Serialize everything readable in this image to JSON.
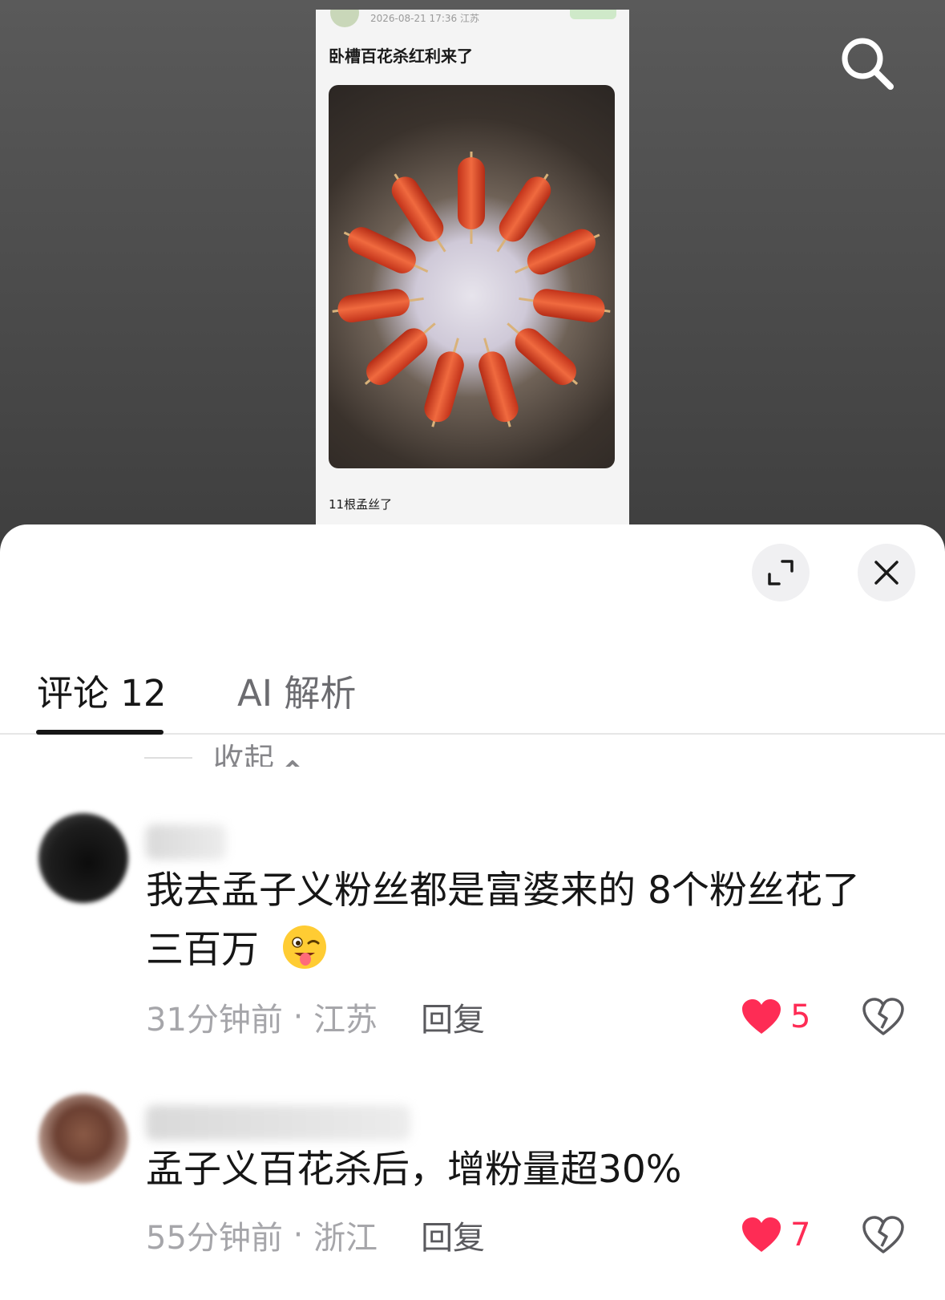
{
  "post": {
    "meta": "2026-08-21 17:36 江苏",
    "title": "卧槽百花杀红利来了",
    "caption": "11根孟丝了"
  },
  "sheet": {
    "tabs": [
      {
        "label": "评论 12",
        "active": true
      },
      {
        "label": "AI 解析",
        "active": false
      }
    ],
    "collapse_label": "收起"
  },
  "comments": [
    {
      "text": "我去孟子义粉丝都是富婆来的  8个粉丝花了三百万",
      "emoji": "winking-face-with-tongue",
      "time": "31分钟前",
      "location": "江苏",
      "reply_label": "回复",
      "likes": "5"
    },
    {
      "text": "孟子义百花杀后，增粉量超30%",
      "time": "55分钟前",
      "location": "浙江",
      "reply_label": "回复",
      "likes": "7"
    }
  ],
  "colors": {
    "accent_like": "#fe2c55",
    "tab_active": "#161616",
    "tab_inactive": "#6c6c70",
    "meta_text": "#a6a6aa"
  },
  "icons": [
    "search-icon",
    "expand-icon",
    "close-icon",
    "chevron-up-icon",
    "heart-icon",
    "broken-heart-icon"
  ]
}
